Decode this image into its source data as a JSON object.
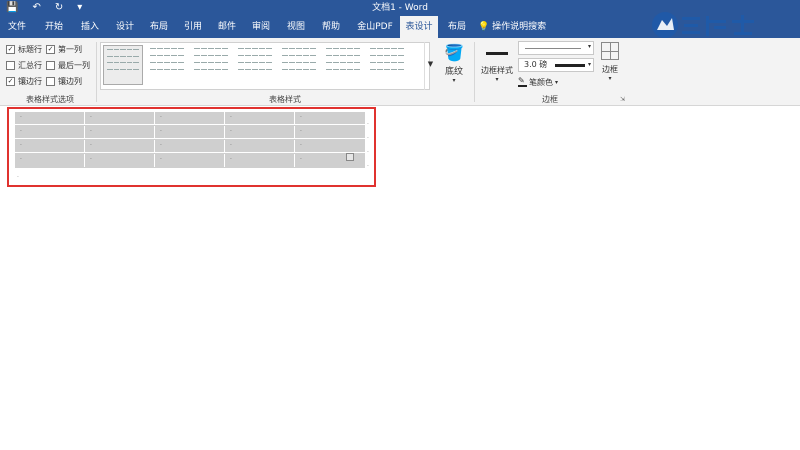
{
  "colors": {
    "accent": "#2b579a",
    "ribbon_bg": "#f3f3f3",
    "highlight": "#e0322f",
    "table_fill": "#cfcfcf"
  },
  "title_bar": {
    "doc_title": "文档1 - Word",
    "qat": [
      {
        "icon": "save-icon",
        "glyph": "💾"
      },
      {
        "icon": "undo-icon",
        "glyph": "↶"
      },
      {
        "icon": "redo-icon",
        "glyph": "↻"
      },
      {
        "icon": "customize-icon",
        "glyph": "▾"
      }
    ]
  },
  "tabs": [
    {
      "label": "文件"
    },
    {
      "label": "开始"
    },
    {
      "label": "插入"
    },
    {
      "label": "设计"
    },
    {
      "label": "布局"
    },
    {
      "label": "引用"
    },
    {
      "label": "邮件"
    },
    {
      "label": "审阅"
    },
    {
      "label": "视图"
    },
    {
      "label": "帮助"
    },
    {
      "label": "金山PDF"
    },
    {
      "label": "表设计",
      "active": true
    },
    {
      "label": "布局"
    }
  ],
  "tell_me": "操作说明搜索",
  "watermark": "云骑士",
  "ribbon": {
    "options_group": {
      "label": "表格样式选项",
      "items": [
        {
          "label": "标题行",
          "checked": true
        },
        {
          "label": "第一列",
          "checked": true
        },
        {
          "label": "汇总行",
          "checked": false
        },
        {
          "label": "最后一列",
          "checked": false
        },
        {
          "label": "镶边行",
          "checked": true
        },
        {
          "label": "镶边列",
          "checked": false
        }
      ]
    },
    "styles_group": {
      "label": "表格样式",
      "shading_label": "底纹"
    },
    "borders_group": {
      "label": "边框",
      "border_styles_label": "边框样式",
      "line_weight": "3.0 磅",
      "pen_color_label": "笔颜色",
      "borders_label": "边框"
    }
  },
  "document": {
    "table": {
      "rows": 4,
      "cols": 5,
      "cell_mark": "·"
    }
  }
}
